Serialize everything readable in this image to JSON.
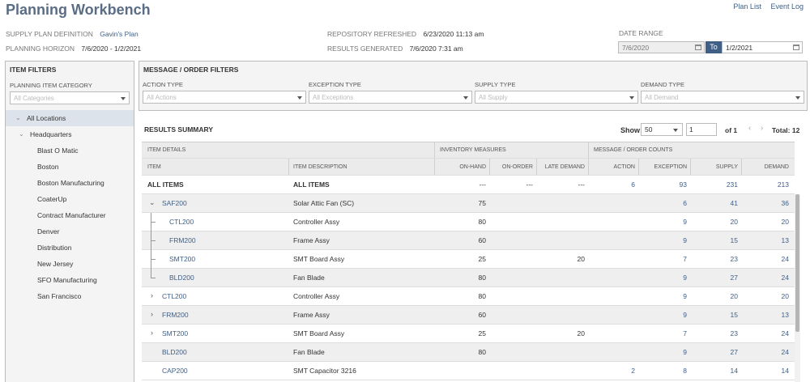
{
  "app": {
    "title": "Planning Workbench",
    "links": [
      "Plan List",
      "Event Log"
    ]
  },
  "header": {
    "supply_plan_label": "SUPPLY PLAN DEFINITION",
    "supply_plan_value": "Gavin's Plan",
    "horizon_label": "PLANNING HORIZON",
    "horizon_value": "7/6/2020 - 1/2/2021",
    "repo_label": "REPOSITORY REFRESHED",
    "repo_value": "6/23/2020 11:13 am",
    "results_label": "RESULTS GENERATED",
    "results_value": "7/6/2020 7:31 am",
    "date_range_label": "DATE RANGE",
    "date_from": "7/6/2020",
    "date_to_label": "To",
    "date_to": "1/2/2021"
  },
  "item_filters": {
    "title": "ITEM FILTERS",
    "category_label": "PLANNING ITEM CATEGORY",
    "category_placeholder": "All Categories",
    "locations": [
      {
        "label": "All Locations",
        "level": 0,
        "selected": true,
        "expanded": true
      },
      {
        "label": "Headquarters",
        "level": 1,
        "selected": false,
        "expanded": true
      },
      {
        "label": "Blast O Matic",
        "level": 2
      },
      {
        "label": "Boston",
        "level": 2
      },
      {
        "label": "Boston Manufacturing",
        "level": 2
      },
      {
        "label": "CoaterUp",
        "level": 2
      },
      {
        "label": "Contract Manufacturer",
        "level": 2
      },
      {
        "label": "Denver",
        "level": 2
      },
      {
        "label": "Distribution",
        "level": 2
      },
      {
        "label": "New Jersey",
        "level": 2
      },
      {
        "label": "SFO Manufacturing",
        "level": 2
      },
      {
        "label": "San Francisco",
        "level": 2
      }
    ]
  },
  "order_filters": {
    "title": "MESSAGE / ORDER FILTERS",
    "filters": [
      {
        "label": "ACTION TYPE",
        "placeholder": "All Actions"
      },
      {
        "label": "EXCEPTION TYPE",
        "placeholder": "All Exceptions"
      },
      {
        "label": "SUPPLY TYPE",
        "placeholder": "All Supply"
      },
      {
        "label": "DEMAND TYPE",
        "placeholder": "All Demand"
      }
    ]
  },
  "results": {
    "title": "RESULTS SUMMARY",
    "show_label": "Show:",
    "show_value": "50",
    "page_value": "1",
    "of_label": "of 1",
    "total_label": "Total: 12",
    "group_headers": {
      "item_details": "ITEM DETAILS",
      "inventory_measures": "INVENTORY MEASURES",
      "message_counts": "MESSAGE / ORDER COUNTS"
    },
    "columns": {
      "item": "ITEM",
      "description": "ITEM DESCRIPTION",
      "on_hand": "ON-HAND",
      "on_order": "ON-ORDER",
      "late_demand": "LATE DEMAND",
      "action": "ACTION",
      "exception": "EXCEPTION",
      "supply": "SUPPLY",
      "demand": "DEMAND"
    },
    "rows": [
      {
        "item": "ALL ITEMS",
        "description": "ALL ITEMS",
        "on_hand": "---",
        "on_order": "---",
        "late_demand": "---",
        "action": "6",
        "exception": "93",
        "supply": "231",
        "demand": "213",
        "kind": "all"
      },
      {
        "item": "SAF200",
        "description": "Solar Attic Fan (SC)",
        "on_hand": "75",
        "on_order": "",
        "late_demand": "",
        "action": "",
        "exception": "6",
        "supply": "41",
        "demand": "36",
        "kind": "expanded"
      },
      {
        "item": "CTL200",
        "description": "Controller Assy",
        "on_hand": "80",
        "on_order": "",
        "late_demand": "",
        "action": "",
        "exception": "9",
        "supply": "20",
        "demand": "20",
        "kind": "child"
      },
      {
        "item": "FRM200",
        "description": "Frame Assy",
        "on_hand": "60",
        "on_order": "",
        "late_demand": "",
        "action": "",
        "exception": "9",
        "supply": "15",
        "demand": "13",
        "kind": "child"
      },
      {
        "item": "SMT200",
        "description": "SMT Board Assy",
        "on_hand": "25",
        "on_order": "",
        "late_demand": "20",
        "action": "",
        "exception": "7",
        "supply": "23",
        "demand": "24",
        "kind": "child"
      },
      {
        "item": "BLD200",
        "description": "Fan Blade",
        "on_hand": "80",
        "on_order": "",
        "late_demand": "",
        "action": "",
        "exception": "9",
        "supply": "27",
        "demand": "24",
        "kind": "child-last"
      },
      {
        "item": "CTL200",
        "description": "Controller Assy",
        "on_hand": "80",
        "on_order": "",
        "late_demand": "",
        "action": "",
        "exception": "9",
        "supply": "20",
        "demand": "20",
        "kind": "collapsed"
      },
      {
        "item": "FRM200",
        "description": "Frame Assy",
        "on_hand": "60",
        "on_order": "",
        "late_demand": "",
        "action": "",
        "exception": "9",
        "supply": "15",
        "demand": "13",
        "kind": "collapsed"
      },
      {
        "item": "SMT200",
        "description": "SMT Board Assy",
        "on_hand": "25",
        "on_order": "",
        "late_demand": "20",
        "action": "",
        "exception": "7",
        "supply": "23",
        "demand": "24",
        "kind": "collapsed"
      },
      {
        "item": "BLD200",
        "description": "Fan Blade",
        "on_hand": "80",
        "on_order": "",
        "late_demand": "",
        "action": "",
        "exception": "9",
        "supply": "27",
        "demand": "24",
        "kind": "leaf"
      },
      {
        "item": "CAP200",
        "description": "SMT Capacitor 3216",
        "on_hand": "",
        "on_order": "",
        "late_demand": "",
        "action": "2",
        "exception": "8",
        "supply": "14",
        "demand": "14",
        "kind": "leaf"
      }
    ]
  },
  "colors": {
    "accent": "#3f5f86",
    "title": "#5a6d85",
    "panel": "#f4f4f4",
    "selected": "#dde3ea"
  }
}
